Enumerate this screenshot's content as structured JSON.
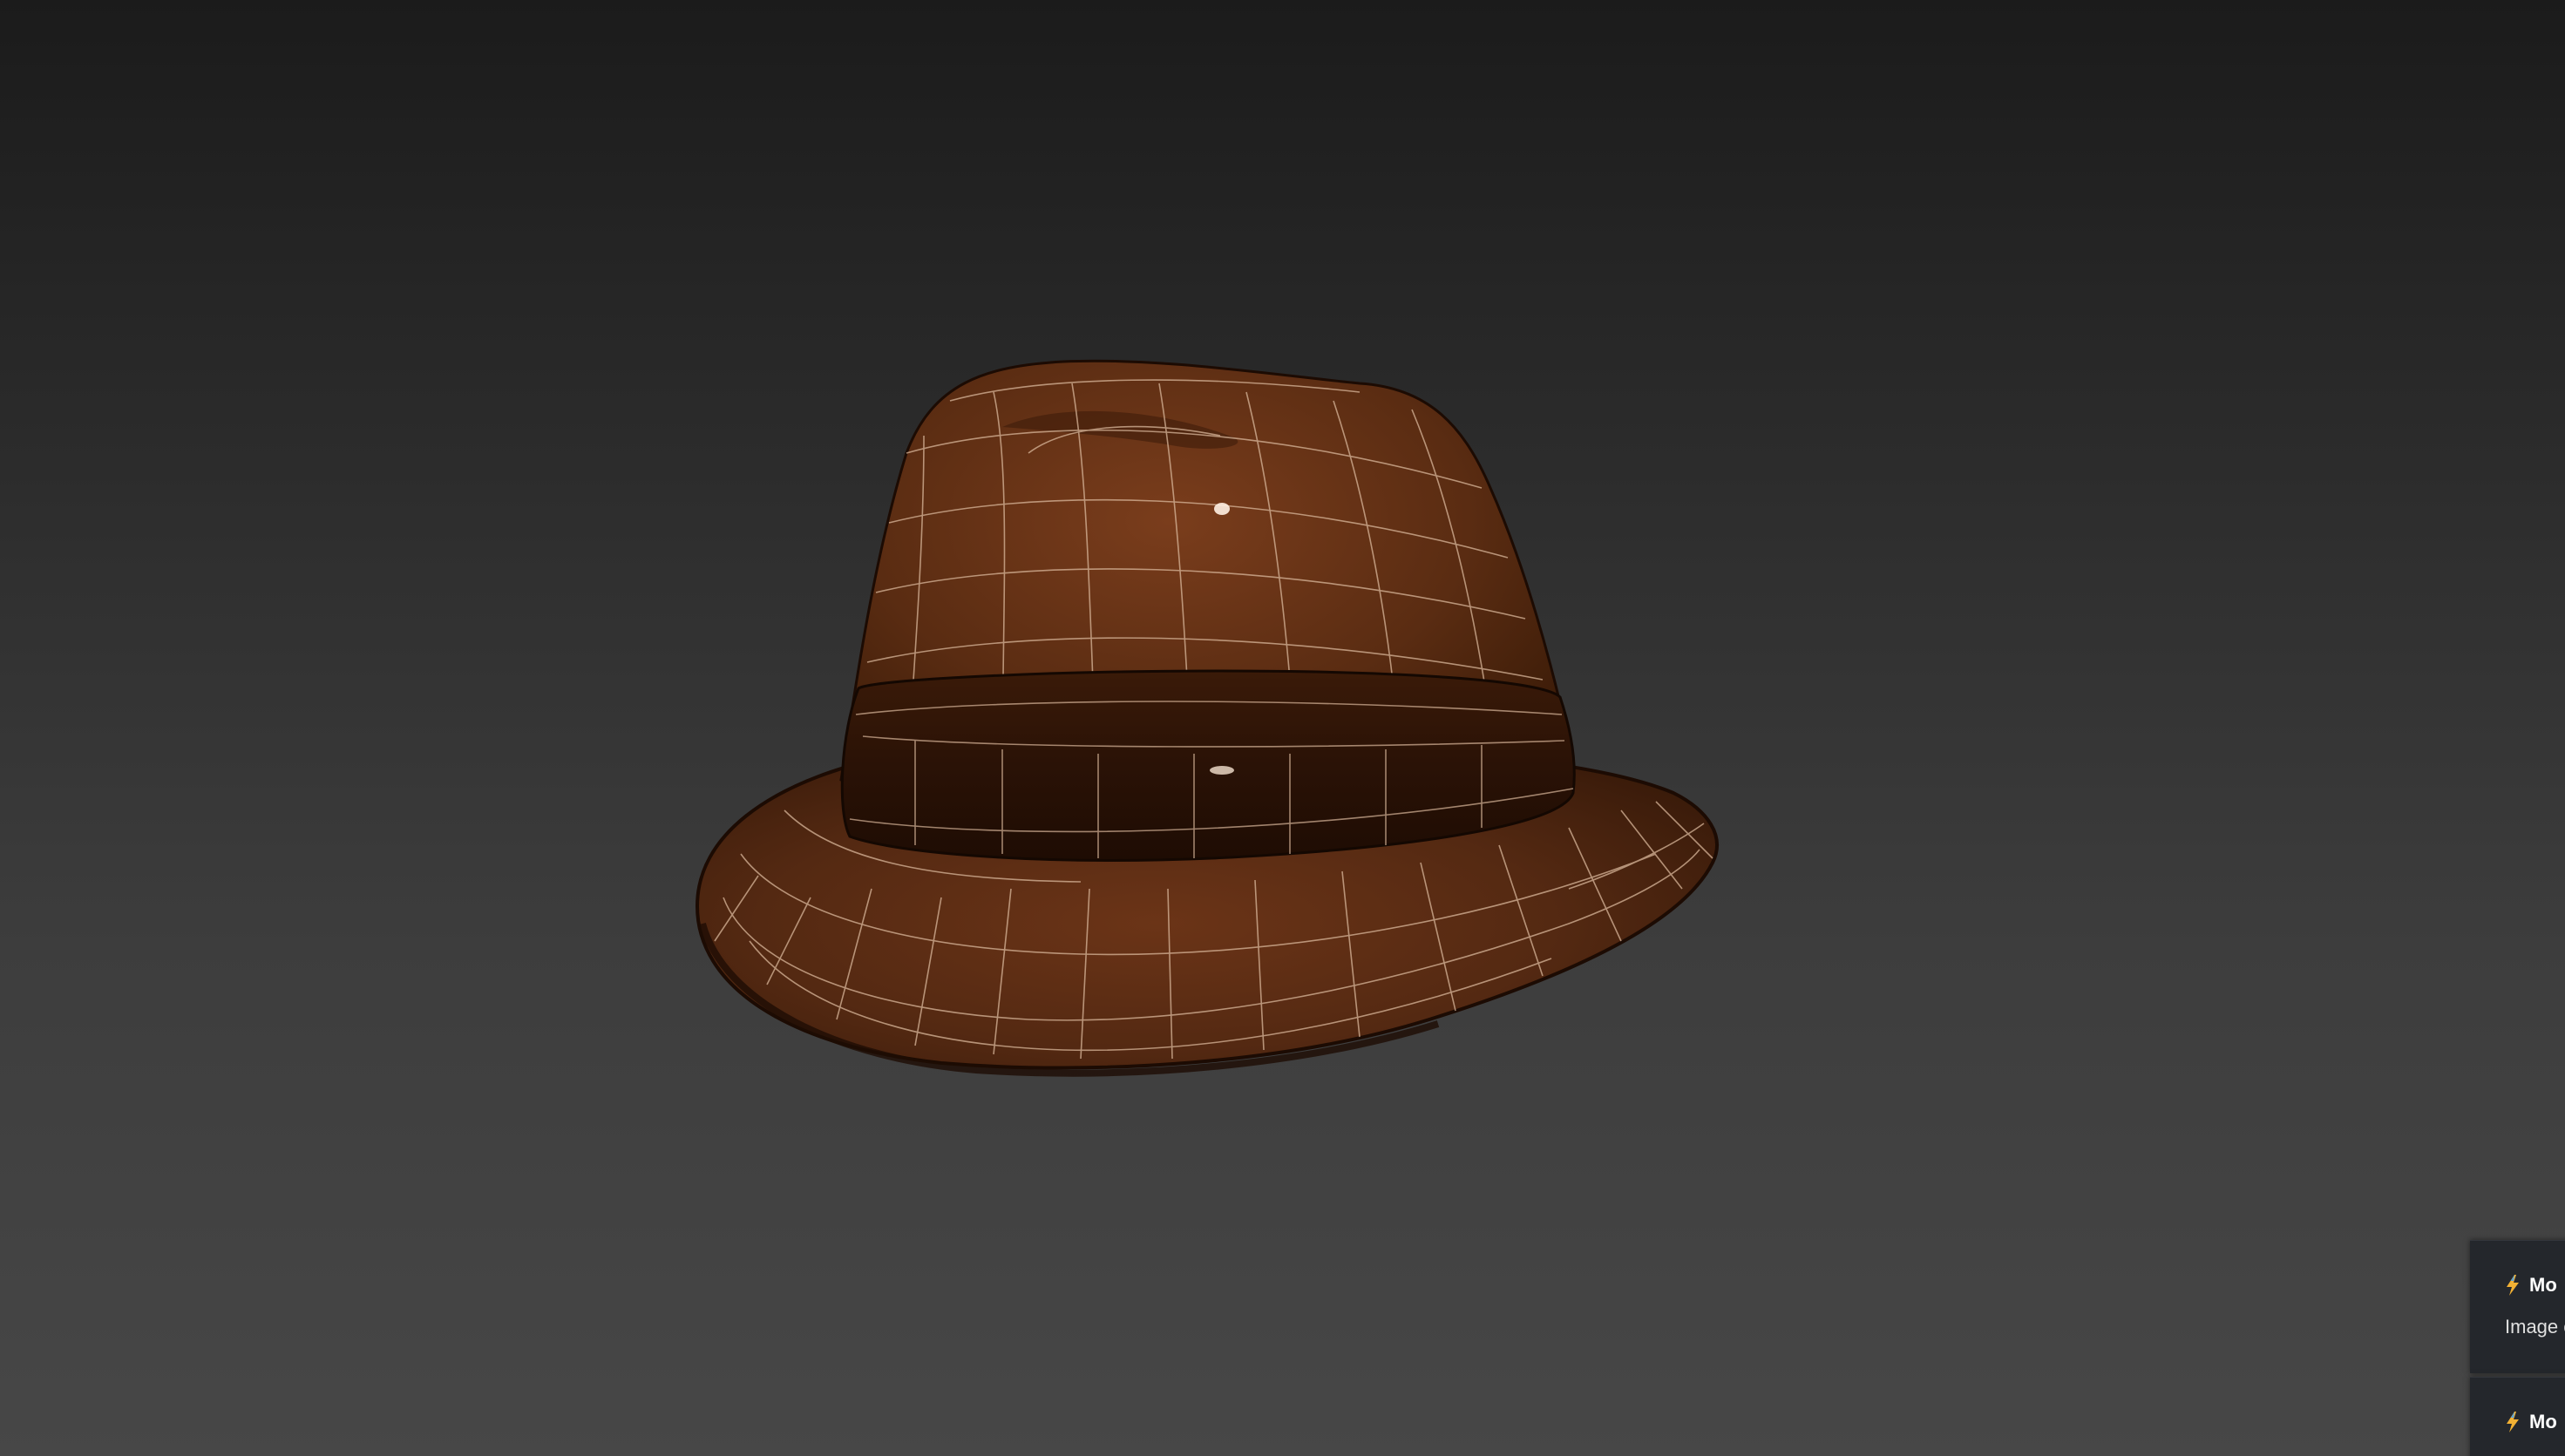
{
  "viewport": {
    "background_top": "#1b1b1b",
    "background_bottom": "#474747",
    "model": {
      "name": "fedora-hat",
      "material_color": "#5a2c12",
      "wire_color": "#d9b79b"
    }
  },
  "notifications": [
    {
      "icon": "lightning-bolt-icon",
      "title": "Mo",
      "message": "Image c"
    },
    {
      "icon": "lightning-bolt-icon",
      "title": "Mo",
      "message": ""
    }
  ]
}
